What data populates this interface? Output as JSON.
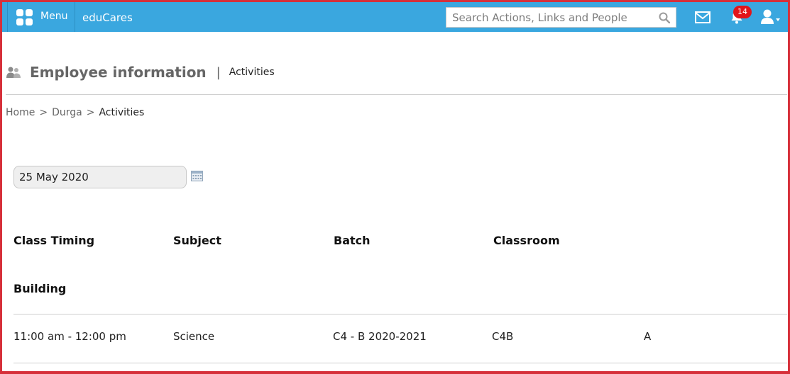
{
  "topbar": {
    "menu_label": "Menu",
    "brand": "eduCares",
    "search_placeholder": "Search Actions, Links and People",
    "notification_count": "14",
    "background_color": "#3aa7df"
  },
  "header": {
    "title": "Employee information",
    "separator": "|",
    "subtitle": "Activities"
  },
  "breadcrumb": {
    "items": [
      "Home",
      "Durga",
      "Activities"
    ],
    "separator": ">"
  },
  "date_picker": {
    "value": "25 May 2020"
  },
  "table": {
    "columns": [
      "Class Timing",
      "Subject",
      "Batch",
      "Classroom",
      "Building"
    ],
    "rows": [
      [
        "11:00 am - 12:00 pm",
        "Science",
        "C4 - B 2020-2021",
        "C4B",
        "A"
      ]
    ]
  },
  "icons": {
    "menu": "grid-icon",
    "search": "search-icon",
    "mail": "mail-icon",
    "notifications": "bell-icon",
    "user": "user-icon",
    "page": "people-icon",
    "calendar": "calendar-icon"
  }
}
